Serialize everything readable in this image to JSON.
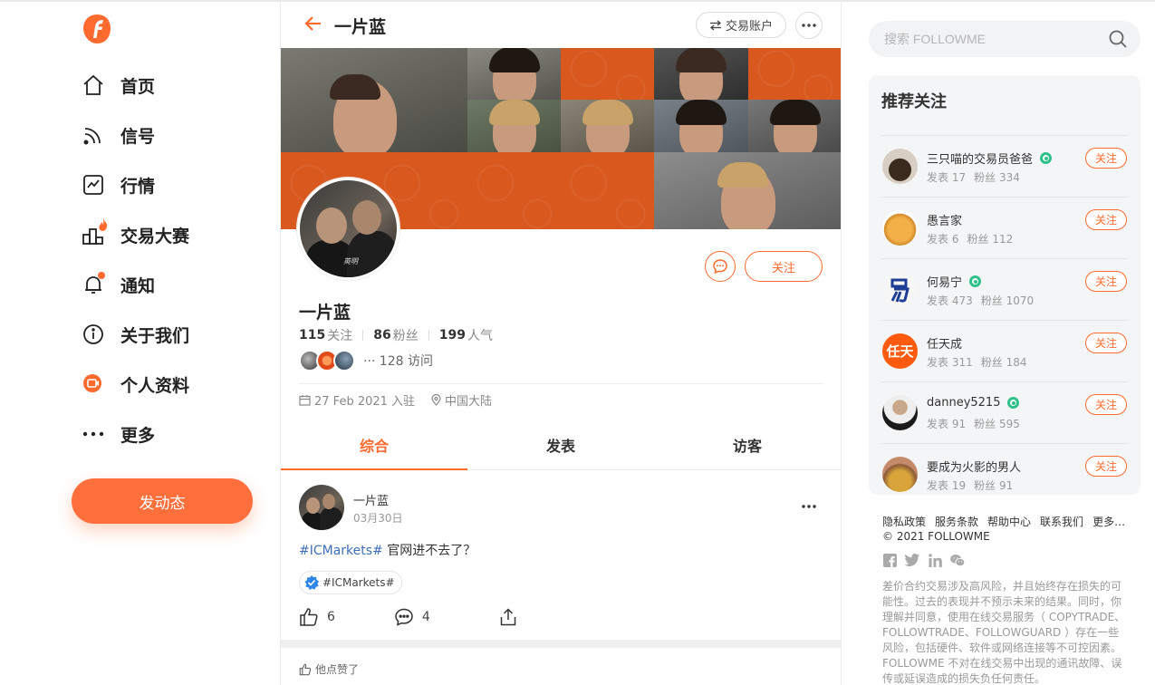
{
  "colors": {
    "accent": "#ff6a2e",
    "verified": "#2ec28a",
    "topic_link": "#3d6fb8"
  },
  "sidebar": {
    "items": [
      {
        "label": "首页",
        "icon": "home-icon"
      },
      {
        "label": "信号",
        "icon": "signal-feed-icon"
      },
      {
        "label": "行情",
        "icon": "market-chart-icon"
      },
      {
        "label": "交易大赛",
        "icon": "contest-bar-icon"
      },
      {
        "label": "通知",
        "icon": "bell-icon"
      },
      {
        "label": "关于我们",
        "icon": "info-icon"
      },
      {
        "label": "个人资料",
        "icon": "profile-icon"
      },
      {
        "label": "更多",
        "icon": "more-dots-icon"
      }
    ],
    "post_button": "发动态"
  },
  "header": {
    "title": "一片蓝",
    "account_button": "交易账户"
  },
  "profile": {
    "name": "一片蓝",
    "following_count": "115",
    "following_label": "关注",
    "followers_count": "86",
    "followers_label": "粉丝",
    "popularity_count": "199",
    "popularity_label": "人气",
    "visits": "··· 128 访问",
    "joined": "27 Feb 2021 入驻",
    "location": "中国大陆",
    "follow_button": "关注",
    "avatar_signature": "英明"
  },
  "tabs": [
    "综合",
    "发表",
    "访客"
  ],
  "post": {
    "author": "一片蓝",
    "date": "03月30日",
    "topic": "#ICMarkets#",
    "text": " 官网进不去了？",
    "chip": "#ICMarkets#",
    "likes": "6",
    "comments": "4"
  },
  "liked_by": "他点赞了",
  "search": {
    "placeholder": "搜索 FOLLOWME"
  },
  "recommend": {
    "title": "推荐关注",
    "follow_label": "关注",
    "posts_label": "发表",
    "fans_label": "粉丝",
    "users": [
      {
        "name": "三只喵的交易员爸爸",
        "posts": "17",
        "fans": "334",
        "verified": true
      },
      {
        "name": "愚言家",
        "posts": "6",
        "fans": "112",
        "verified": false
      },
      {
        "name": "何易宁",
        "posts": "473",
        "fans": "1070",
        "verified": true
      },
      {
        "name": "任天成",
        "posts": "311",
        "fans": "184",
        "verified": false,
        "avatar_text": "任天"
      },
      {
        "name": "danney5215",
        "posts": "91",
        "fans": "595",
        "verified": true
      },
      {
        "name": "要成为火影的男人",
        "posts": "19",
        "fans": "91",
        "verified": false
      }
    ]
  },
  "footer": {
    "links": [
      "隐私政策",
      "服务条款",
      "帮助中心",
      "联系我们",
      "更多…"
    ],
    "copyright": "© 2021 FOLLOWME",
    "disclaimer": "差价合约交易涉及高风险，并且始终存在损失的可能性。过去的表现并不预示未来的结果。同时，你理解并同意，使用在线交易服务（ COPYTRADE、FOLLOWTRADE、FOLLOWGUARD ）存在一些风险，包括硬件、软件或网络连接等不可控因素。FOLLOWME 不对在线交易中出现的通讯故障、误传或延误造成的损失负任何责任。"
  }
}
